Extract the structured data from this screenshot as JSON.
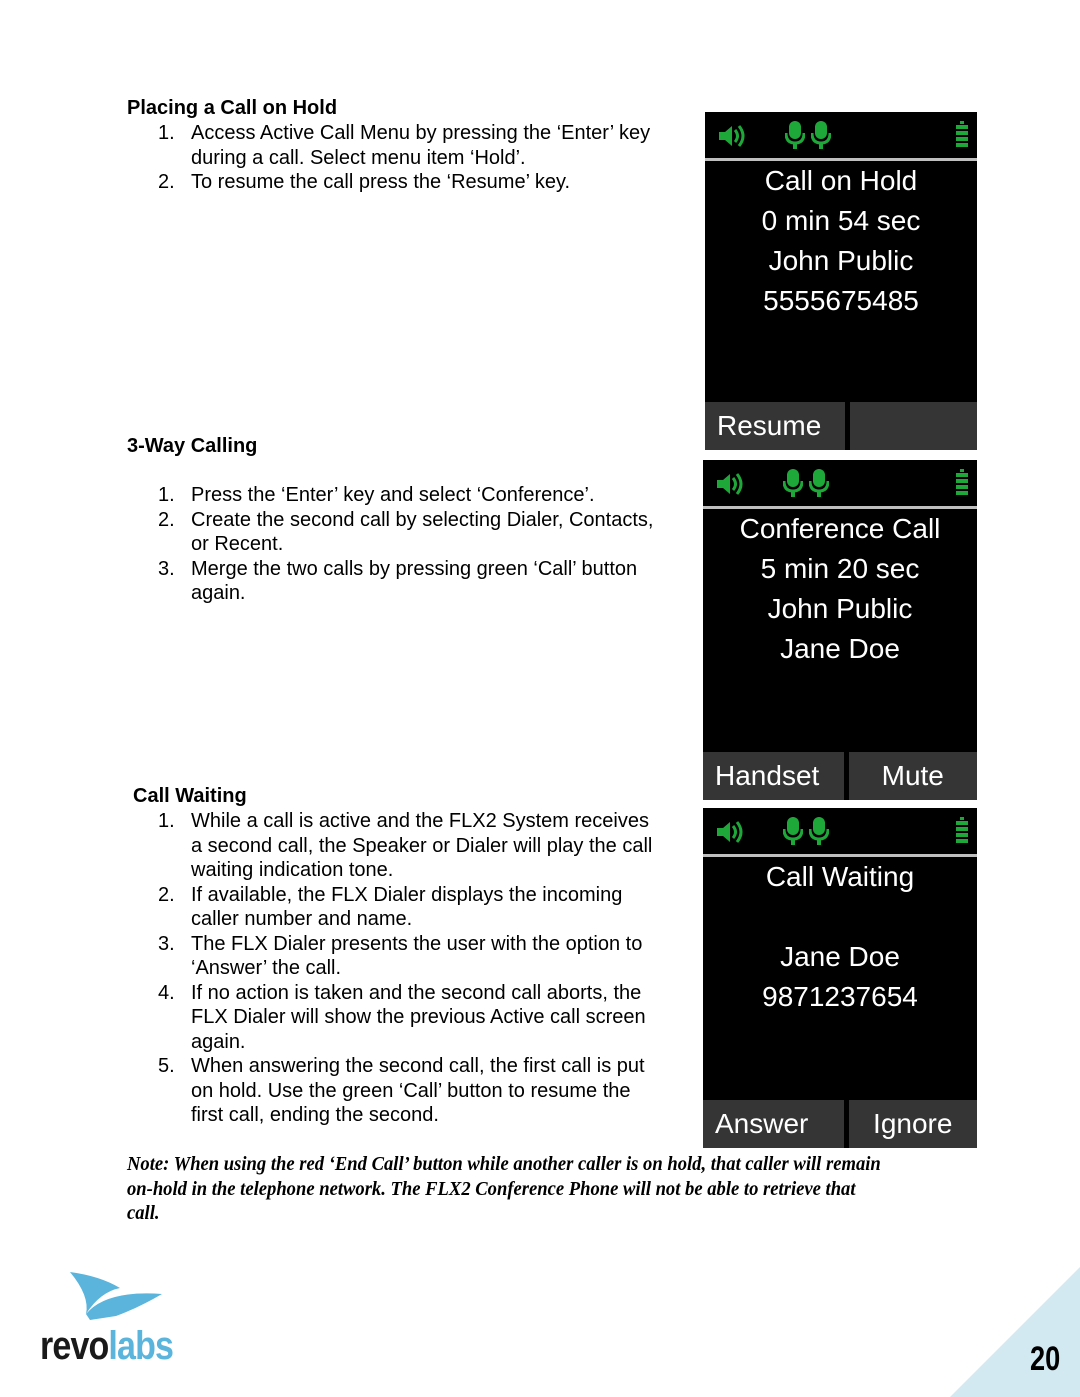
{
  "sections": {
    "hold": {
      "heading": "Placing a Call on Hold",
      "steps": [
        {
          "num": "1.",
          "lines": [
            "Access Active Call Menu by pressing the ‘Enter’ key",
            "during a call. Select menu item ‘Hold’."
          ]
        },
        {
          "num": "2.",
          "lines": [
            "To resume the call press the ‘Resume’ key."
          ]
        }
      ]
    },
    "threeway": {
      "heading": "3-Way Calling",
      "steps": [
        {
          "num": "1.",
          "lines": [
            "Press the ‘Enter’ key and select ‘Conference’."
          ]
        },
        {
          "num": "2.",
          "lines": [
            "Create the second call by selecting Dialer, Contacts,",
            "or Recent."
          ]
        },
        {
          "num": "3.",
          "lines": [
            "Merge the two calls by pressing green ‘Call’ button",
            "again."
          ]
        }
      ]
    },
    "waiting": {
      "heading": "Call Waiting",
      "steps": [
        {
          "num": "1.",
          "lines": [
            "While a call is active and the FLX2 System receives",
            "a second call, the Speaker or Dialer will play the call",
            "waiting indication tone."
          ]
        },
        {
          "num": "2.",
          "lines": [
            "If available, the FLX Dialer displays the incoming",
            "caller number and name."
          ]
        },
        {
          "num": "3.",
          "lines": [
            "The FLX Dialer presents the user with the option to",
            "‘Answer’ the call."
          ]
        },
        {
          "num": "4.",
          "lines": [
            "If no action is taken and the second call aborts, the",
            "FLX Dialer will show the previous Active call screen",
            "again."
          ]
        },
        {
          "num": "5.",
          "lines": [
            "When answering the second call, the first call is put",
            "on hold.  Use the green ‘Call’ button to resume the",
            "first call, ending the second."
          ]
        }
      ]
    }
  },
  "screens": {
    "hold": {
      "icons": [
        "speaker-icon",
        "microphone-icon",
        "microphone-icon",
        "battery-icon"
      ],
      "lines": [
        "Call on Hold",
        "0 min 54 sec",
        "John Public",
        "5555675485"
      ],
      "softkeys": [
        "Resume",
        ""
      ]
    },
    "conference": {
      "icons": [
        "speaker-icon",
        "microphone-icon",
        "microphone-icon",
        "battery-icon"
      ],
      "lines": [
        "Conference Call",
        "5 min 20 sec",
        "John Public",
        "Jane Doe"
      ],
      "softkeys": [
        "Handset",
        "Mute"
      ]
    },
    "waiting": {
      "icons": [
        "speaker-icon",
        "microphone-icon",
        "microphone-icon",
        "battery-icon"
      ],
      "lines": [
        "Call Waiting",
        "",
        "Jane Doe",
        "9871237654"
      ],
      "softkeys": [
        "Answer",
        "Ignore"
      ]
    }
  },
  "note": "Note: When using the red ‘End Call’ button while another caller is on hold, that caller will remain on-hold in the telephone network.  The FLX2 Conference Phone will not be able to retrieve that call.",
  "footer": {
    "logo_text_dark": "revo",
    "logo_text_light": "labs",
    "page_number": "20"
  },
  "colors": {
    "status_green": "#1fa83a",
    "softkey_gray": "#353535",
    "logo_blue": "#5ab4dc",
    "corner_blue": "#d3e9f1"
  }
}
